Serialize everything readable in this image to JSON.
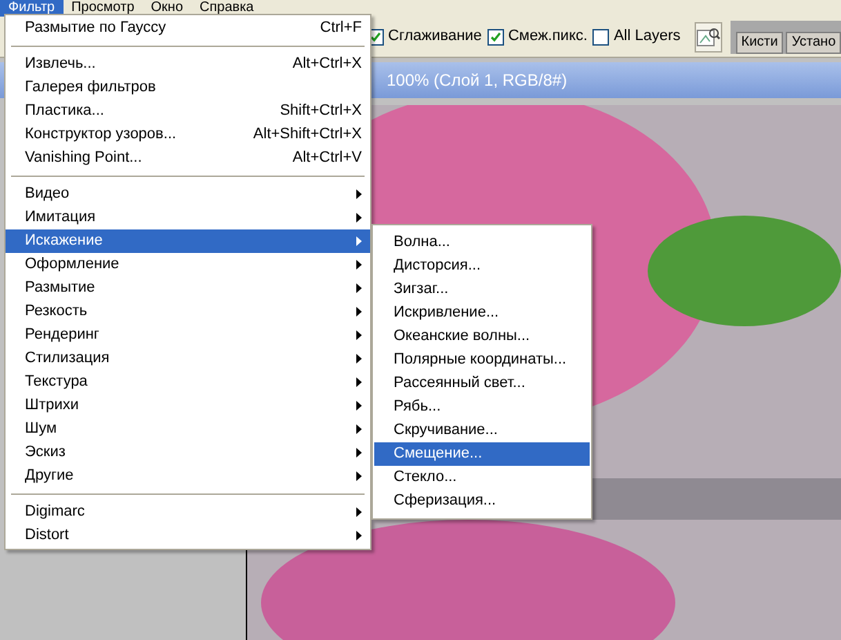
{
  "menubar": [
    {
      "label": "Фильтр",
      "selected": true
    },
    {
      "label": "Просмотр",
      "selected": false
    },
    {
      "label": "Окно",
      "selected": false
    },
    {
      "label": "Справка",
      "selected": false
    }
  ],
  "options": [
    {
      "label": "Сглаживание",
      "checked": true
    },
    {
      "label": "Смеж.пикс.",
      "checked": true
    },
    {
      "label": "All Layers",
      "checked": false
    }
  ],
  "panel_tabs": [
    {
      "label": "Кисти"
    },
    {
      "label": "Устано"
    }
  ],
  "document": {
    "title": "100% (Слой 1, RGB/8#)"
  },
  "filter_menu": [
    [
      {
        "label": "Размытие по Гауссу",
        "shortcut": "Ctrl+F",
        "kind": "command",
        "selected": false
      }
    ],
    [
      {
        "label": "Извлечь...",
        "shortcut": "Alt+Ctrl+X",
        "kind": "command",
        "selected": false
      },
      {
        "label": "Галерея фильтров",
        "kind": "command",
        "selected": false
      },
      {
        "label": "Пластика...",
        "shortcut": "Shift+Ctrl+X",
        "kind": "command",
        "selected": false
      },
      {
        "label": "Конструктор узоров...",
        "shortcut": "Alt+Shift+Ctrl+X",
        "kind": "command",
        "selected": false
      },
      {
        "label": "Vanishing Point...",
        "shortcut": "Alt+Ctrl+V",
        "kind": "command",
        "selected": false
      }
    ],
    [
      {
        "label": "Видео",
        "kind": "submenu",
        "selected": false
      },
      {
        "label": "Имитация",
        "kind": "submenu",
        "selected": false
      },
      {
        "label": "Искажение",
        "kind": "submenu",
        "selected": true
      },
      {
        "label": "Оформление",
        "kind": "submenu",
        "selected": false
      },
      {
        "label": "Размытие",
        "kind": "submenu",
        "selected": false
      },
      {
        "label": "Резкость",
        "kind": "submenu",
        "selected": false
      },
      {
        "label": "Рендеринг",
        "kind": "submenu",
        "selected": false
      },
      {
        "label": "Стилизация",
        "kind": "submenu",
        "selected": false
      },
      {
        "label": "Текстура",
        "kind": "submenu",
        "selected": false
      },
      {
        "label": "Штрихи",
        "kind": "submenu",
        "selected": false
      },
      {
        "label": "Шум",
        "kind": "submenu",
        "selected": false
      },
      {
        "label": "Эскиз",
        "kind": "submenu",
        "selected": false
      },
      {
        "label": "Другие",
        "kind": "submenu",
        "selected": false
      }
    ],
    [
      {
        "label": "Digimarc",
        "kind": "submenu",
        "selected": false
      },
      {
        "label": "Distort",
        "kind": "submenu",
        "selected": false
      }
    ]
  ],
  "distort_submenu": [
    {
      "label": "Волна...",
      "selected": false
    },
    {
      "label": "Дисторсия...",
      "selected": false
    },
    {
      "label": "Зигзаг...",
      "selected": false
    },
    {
      "label": "Искривление...",
      "selected": false
    },
    {
      "label": "Океанские волны...",
      "selected": false
    },
    {
      "label": "Полярные координаты...",
      "selected": false
    },
    {
      "label": "Рассеянный свет...",
      "selected": false
    },
    {
      "label": "Рябь...",
      "selected": false
    },
    {
      "label": "Скручивание...",
      "selected": false
    },
    {
      "label": "Смещение...",
      "selected": true
    },
    {
      "label": "Стекло...",
      "selected": false
    },
    {
      "label": "Сферизация...",
      "selected": false
    }
  ]
}
